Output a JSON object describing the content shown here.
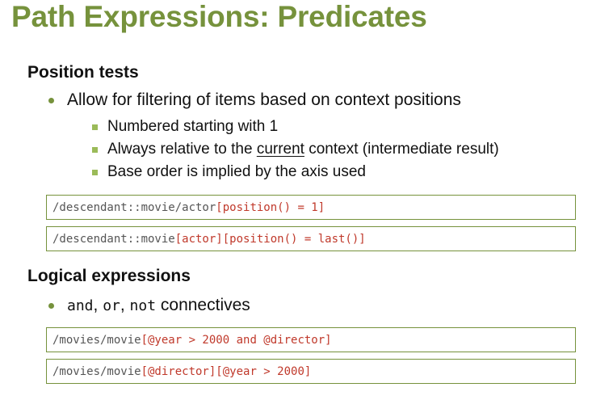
{
  "title": "Path Expressions: Predicates",
  "sections": [
    {
      "heading": "Position tests",
      "bullet": "Allow for filtering of items based on context positions",
      "sub_bullets": [
        "Numbered starting with 1",
        {
          "before": "Always relative to the ",
          "underlined": "current",
          "after": " context (intermediate result)"
        },
        "Base order is implied by the axis used"
      ],
      "code": [
        {
          "path": "/descendant::movie/actor",
          "predicate": "[position() = 1]"
        },
        {
          "path": "/descendant::movie",
          "predicate": "[actor][position() = last()]"
        }
      ]
    },
    {
      "heading": "Logical expressions",
      "bullet": {
        "kw1": "and",
        "sep1": ", ",
        "kw2": "or",
        "sep2": ", ",
        "kw3": "not",
        "rest": " connectives"
      },
      "code": [
        {
          "path": "/movies/movie",
          "predicate": "[@year > 2000 and @director]"
        },
        {
          "path": "/movies/movie",
          "predicate": "[@director][@year > 2000]"
        }
      ]
    }
  ],
  "colors": {
    "accent": "#76923c",
    "sub_bullet": "#9bbb59",
    "code_predicate": "#c0392b",
    "code_path": "#555555"
  }
}
